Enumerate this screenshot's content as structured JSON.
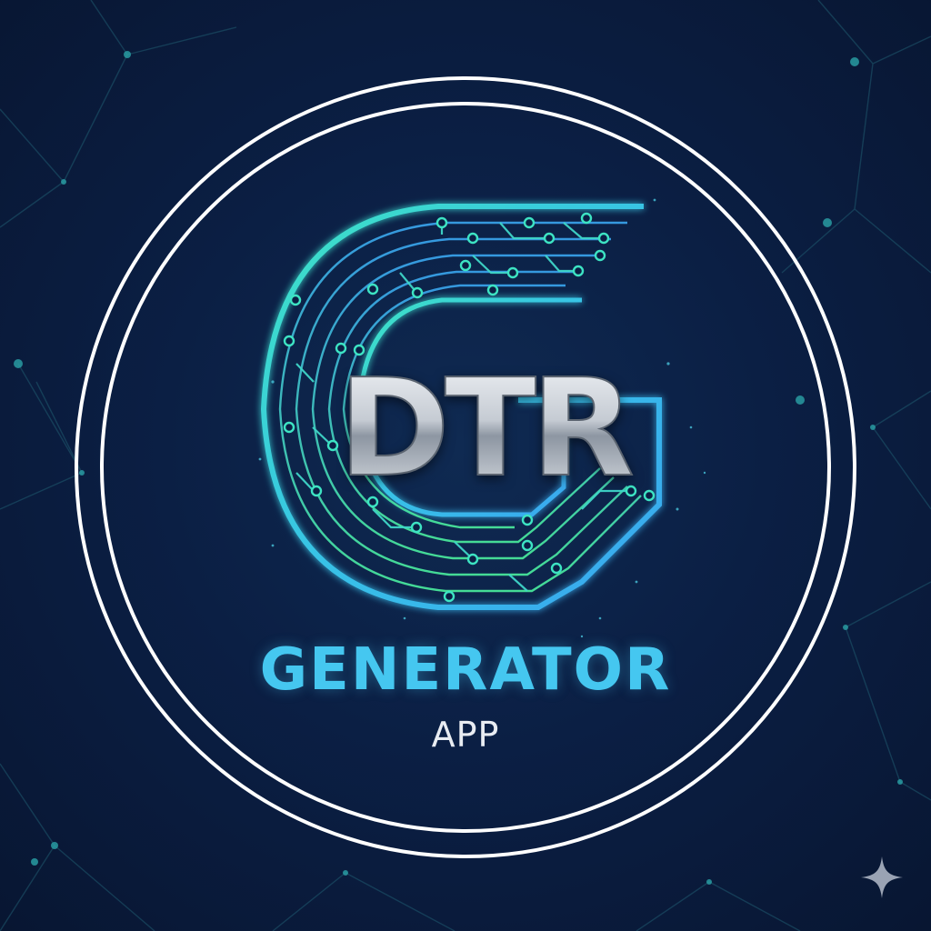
{
  "brand": {
    "monogram": "DTR",
    "name": "GENERATOR",
    "subtitle": "APP"
  },
  "icons": {
    "emblem": "circuit-g-icon",
    "corner": "sparkle-icon"
  },
  "colors": {
    "background": "#0b1f44",
    "ring": "#ffffff",
    "circuit_teal": "#3de3c3",
    "circuit_blue": "#3ab4f0",
    "title": "#45c7f0",
    "subtitle": "#e8ecf2",
    "monogram_silver": "#c9ced6"
  }
}
